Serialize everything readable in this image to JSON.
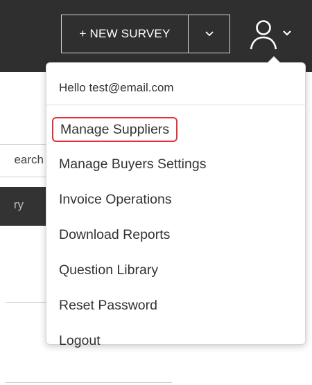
{
  "header": {
    "new_survey_label": "+ NEW SURVEY",
    "caret_icon": "chevron-down-icon",
    "user_icon": "user-icon"
  },
  "background": {
    "search_text": "earch",
    "tab_text": "ry"
  },
  "dropdown": {
    "greeting": "Hello test@email.com",
    "items": [
      {
        "label": "Manage Suppliers",
        "highlighted": true
      },
      {
        "label": "Manage Buyers Settings"
      },
      {
        "label": "Invoice Operations"
      },
      {
        "label": "Download Reports"
      },
      {
        "label": "Question Library"
      },
      {
        "label": "Reset Password"
      },
      {
        "label": "Logout"
      }
    ]
  },
  "colors": {
    "header_bg": "#2f2f2f",
    "highlight_border": "#e2323a",
    "text": "#333333"
  }
}
